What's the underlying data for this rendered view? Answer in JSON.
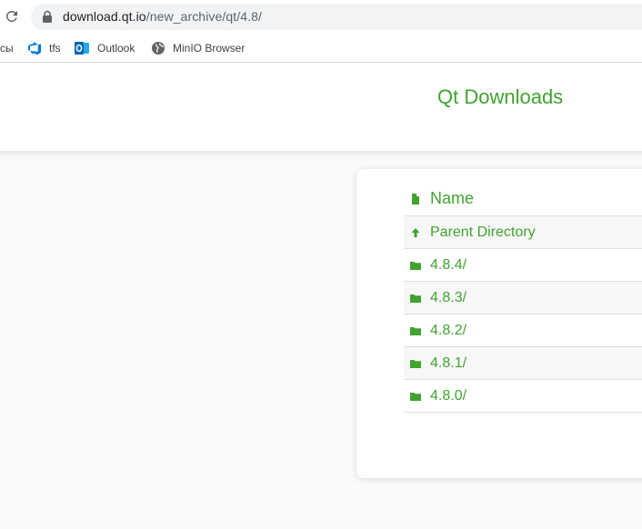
{
  "browser": {
    "url_host": "download.qt.io",
    "url_path": "/new_archive/qt/4.8/"
  },
  "bookmarks": {
    "items": [
      {
        "label": "сы",
        "icon": "truncated"
      },
      {
        "label": "tfs",
        "icon": "azure-devops-icon"
      },
      {
        "label": "Outlook",
        "icon": "outlook-icon"
      },
      {
        "label": "MinIO Browser",
        "icon": "globe-icon"
      }
    ]
  },
  "page": {
    "title": "Qt Downloads",
    "table": {
      "header": {
        "label": "Name",
        "icon": "file-icon"
      },
      "rows": [
        {
          "label": "Parent Directory",
          "icon": "arrow-up-icon"
        },
        {
          "label": "4.8.4/",
          "icon": "folder-icon"
        },
        {
          "label": "4.8.3/",
          "icon": "folder-icon"
        },
        {
          "label": "4.8.2/",
          "icon": "folder-icon"
        },
        {
          "label": "4.8.1/",
          "icon": "folder-icon"
        },
        {
          "label": "4.8.0/",
          "icon": "folder-icon"
        }
      ]
    }
  },
  "colors": {
    "accent": "#41a22f",
    "url_bar": "#f1f3f4"
  }
}
